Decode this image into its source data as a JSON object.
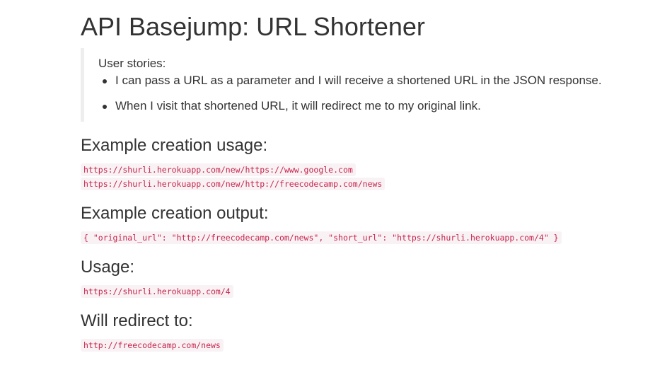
{
  "page": {
    "title": "API Basejump: URL Shortener"
  },
  "stories": {
    "heading": "User stories:",
    "items": [
      "I can pass a URL as a parameter and I will receive a shortened URL in the JSON response.",
      "When I visit that shortened URL, it will redirect me to my original link."
    ]
  },
  "sections": {
    "creation_usage": {
      "heading": "Example creation usage:",
      "examples": [
        "https://shurli.herokuapp.com/new/https://www.google.com",
        "https://shurli.herokuapp.com/new/http://freecodecamp.com/news"
      ]
    },
    "creation_output": {
      "heading": "Example creation output:",
      "example": "{ \"original_url\": \"http://freecodecamp.com/news\", \"short_url\": \"https://shurli.herokuapp.com/4\" }"
    },
    "usage": {
      "heading": "Usage:",
      "example": "https://shurli.herokuapp.com/4"
    },
    "redirect": {
      "heading": "Will redirect to:",
      "example": "http://freecodecamp.com/news"
    }
  },
  "colors": {
    "code_text": "#c7254e",
    "code_background": "#f9f2f4",
    "blockquote_border": "#eeeeee",
    "body_text": "#333333"
  }
}
